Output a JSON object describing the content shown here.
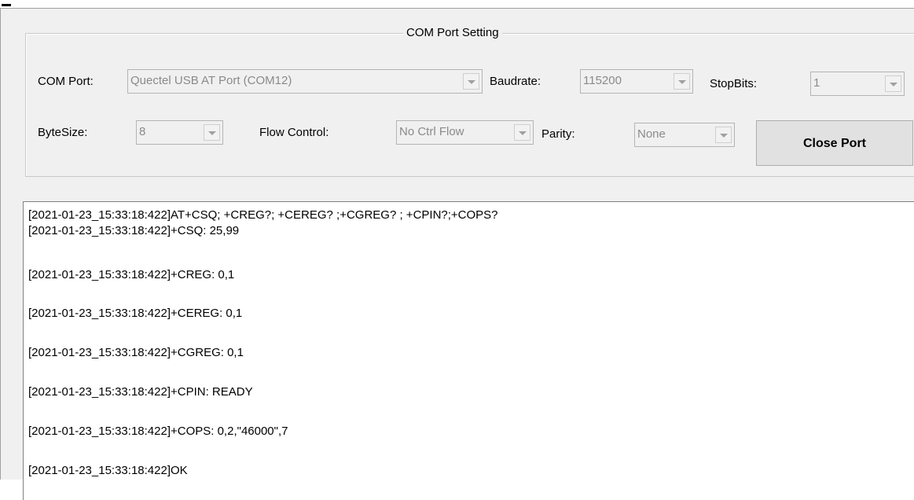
{
  "group": {
    "title": "COM Port Setting"
  },
  "row1": {
    "com_port_label": "COM Port:",
    "com_port_value": "Quectel USB AT Port (COM12)",
    "baudrate_label": "Baudrate:",
    "baudrate_value": "115200",
    "stopbits_label": "StopBits:",
    "stopbits_value": "1"
  },
  "row2": {
    "bytesize_label": "ByteSize:",
    "bytesize_value": "8",
    "flow_label": "Flow Control:",
    "flow_value": "No Ctrl Flow",
    "parity_label": "Parity:",
    "parity_value": "None",
    "close_button": "Close Port"
  },
  "log": {
    "lines": [
      "[2021-01-23_15:33:18:422]AT+CSQ; +CREG?; +CEREG? ;+CGREG? ; +CPIN?;+COPS?",
      "[2021-01-23_15:33:18:422]+CSQ: 25,99",
      "[2021-01-23_15:33:18:422]+CREG: 0,1",
      "[2021-01-23_15:33:18:422]+CEREG: 0,1",
      "[2021-01-23_15:33:18:422]+CGREG: 0,1",
      "[2021-01-23_15:33:18:422]+CPIN: READY",
      "[2021-01-23_15:33:18:422]+COPS: 0,2,\"46000\",7",
      "[2021-01-23_15:33:18:422]OK"
    ]
  }
}
